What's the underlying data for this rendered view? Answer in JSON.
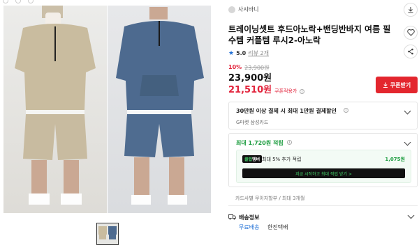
{
  "seller": {
    "name": "사시바니"
  },
  "product": {
    "title": "트레이닝셋트 후드아노락+밴딩반바지 여름 필수템 커플템 루시2-아노락",
    "rating": {
      "score": "5.0",
      "reviews": "리뷰 2개"
    },
    "discount_pct": "10%",
    "original_price": "23,900원",
    "price": "23,900원",
    "coupon_price": "21,510원",
    "coupon_note": "쿠폰적용가"
  },
  "coupon_button": {
    "label": "쿠폰받기"
  },
  "card_discount": {
    "title": "30만원 이상 결제 시 최대 1만원 결제할인",
    "subtitle": "G마켓 삼성카드"
  },
  "reward": {
    "title": "최대 1,720원 적립",
    "tag_brand": "멤버",
    "tag_prefix": "클럽",
    "promo_text": "최대 5% 추가 적립",
    "promo_amount": "1,075원",
    "cta": "지금 시작하고 최대 적립 받기 >"
  },
  "installment": "카드사별 무이자할부 / 최대 3개월",
  "shipping": {
    "label": "배송정보",
    "fee": "무료배송",
    "carrier": "한진택배"
  },
  "colors": {
    "accent_red": "#e2233b",
    "accent_blue": "#1f6fd6",
    "accent_green": "#1b9c3e"
  },
  "icons": [
    "heart-icon",
    "share-icon",
    "download-icon",
    "star-icon",
    "truck-icon",
    "chevron-down-icon",
    "info-icon"
  ]
}
